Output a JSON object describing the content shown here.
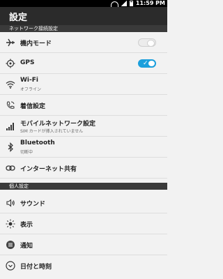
{
  "status_bar": {
    "time": "11:59 PM"
  },
  "header": {
    "title": "設定"
  },
  "sections": {
    "network": "ネットワーク接続設定",
    "personal": "個人設定"
  },
  "items": {
    "airplane": {
      "label": "機内モード",
      "toggle": "off"
    },
    "gps": {
      "label": "GPS",
      "toggle": "on"
    },
    "wifi": {
      "label": "Wi-Fi",
      "sub": "オフライン"
    },
    "call": {
      "label": "着信設定"
    },
    "mobile": {
      "label": "モバイルネットワーク設定",
      "sub": "SIM カードが挿入されていません"
    },
    "bluetooth": {
      "label": "Bluetooth",
      "sub": "切断中"
    },
    "tethering": {
      "label": "インターネット共有"
    },
    "sound": {
      "label": "サウンド"
    },
    "display": {
      "label": "表示"
    },
    "notifications": {
      "label": "通知"
    },
    "datetime": {
      "label": "日付と時刻"
    }
  },
  "colors": {
    "accent": "#1b9fdc",
    "header": "#2b2b2b",
    "section": "#3a3a3a"
  }
}
